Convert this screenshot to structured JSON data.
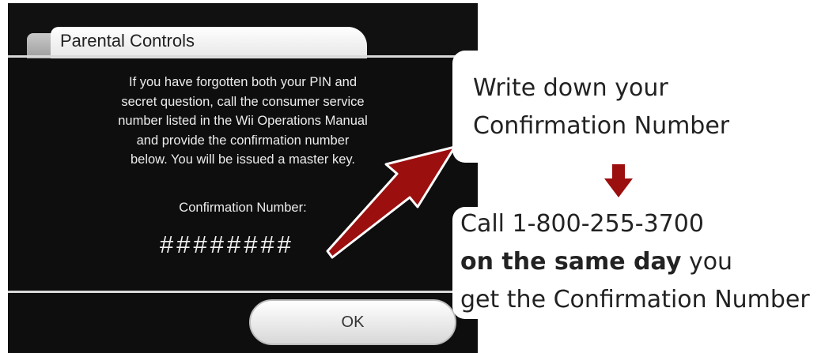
{
  "dialog": {
    "title": "Parental Controls",
    "message_lines": [
      "If you have forgotten both your PIN and",
      "secret question, call the consumer service",
      "number listed in the Wii Operations Manual",
      "and provide the confirmation number",
      "below. You will be issued a master key."
    ],
    "confirmation_label": "Confirmation Number:",
    "confirmation_value": "########",
    "ok_label": "OK"
  },
  "instructions": {
    "step1_line1": "Write down your",
    "step1_line2": "Confirmation Number",
    "step2_line1": "Call 1-800-255-3700",
    "step2_line2_bold": "on the same day",
    "step2_line2_rest": " you",
    "step2_line3": "get the Confirmation Number"
  },
  "colors": {
    "screen_background": "#0e0e0e",
    "arrow_red": "#9b0f0f",
    "dialog_text": "#ececec"
  },
  "icons": {
    "pointer": "diagonal-arrow-icon",
    "step": "down-arrow-icon"
  }
}
